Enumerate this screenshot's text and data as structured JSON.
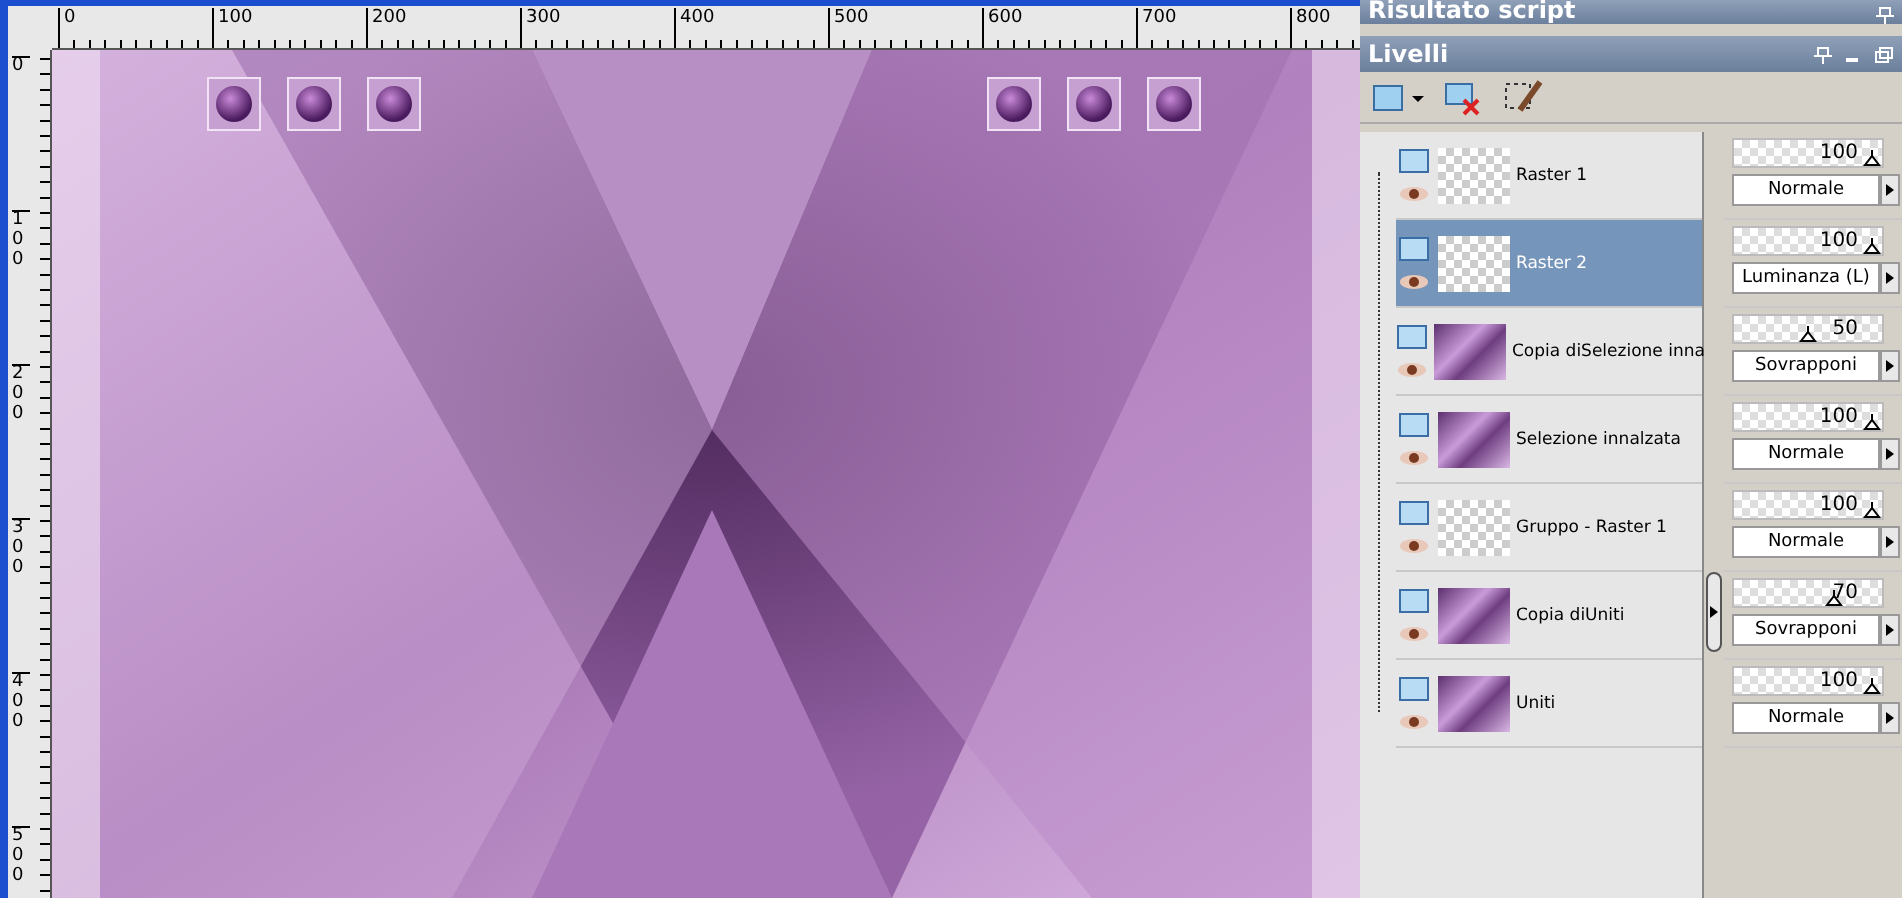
{
  "top_ruler": {
    "labels": [
      "0",
      "100",
      "200",
      "300",
      "400",
      "500",
      "600",
      "700",
      "800"
    ]
  },
  "left_ruler": {
    "labels": [
      "0",
      "100",
      "200",
      "300",
      "400",
      "500"
    ]
  },
  "script_panel": {
    "title": "Risultato script"
  },
  "layers_panel": {
    "title": "Livelli",
    "layers": [
      {
        "name": "Raster 1",
        "selected": false,
        "kind": "transparent",
        "opacity": "100",
        "level": 1,
        "blend": "Normale"
      },
      {
        "name": "Raster 2",
        "selected": true,
        "kind": "transparent",
        "opacity": "100",
        "level": 1,
        "blend": "Luminanza (L)"
      },
      {
        "name": "Copia diSelezione inna",
        "selected": false,
        "kind": "image",
        "opacity": "50",
        "level": 0.5,
        "blend": "Sovrapponi"
      },
      {
        "name": "Selezione innalzata",
        "selected": false,
        "kind": "image",
        "opacity": "100",
        "level": 1,
        "blend": "Normale"
      },
      {
        "name": "Gruppo - Raster 1",
        "selected": false,
        "kind": "transparent",
        "opacity": "100",
        "level": 1,
        "blend": "Normale"
      },
      {
        "name": "Copia diUniti",
        "selected": false,
        "kind": "image",
        "opacity": "70",
        "level": 0.7,
        "blend": "Sovrapponi"
      },
      {
        "name": "Uniti",
        "selected": false,
        "kind": "image",
        "opacity": "100",
        "level": 1,
        "blend": "Normale"
      }
    ]
  }
}
